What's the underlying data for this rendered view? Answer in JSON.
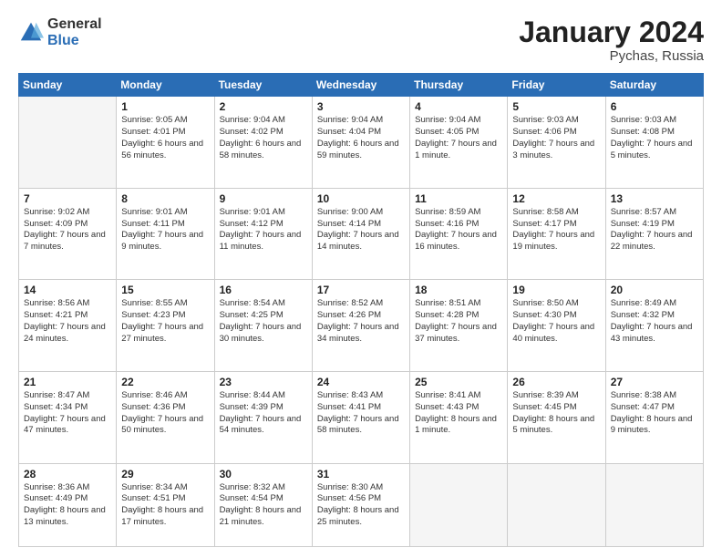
{
  "logo": {
    "general": "General",
    "blue": "Blue"
  },
  "title": {
    "month": "January 2024",
    "location": "Pychas, Russia"
  },
  "days_of_week": [
    "Sunday",
    "Monday",
    "Tuesday",
    "Wednesday",
    "Thursday",
    "Friday",
    "Saturday"
  ],
  "weeks": [
    [
      {
        "day": "",
        "info": ""
      },
      {
        "day": "1",
        "info": "Sunrise: 9:05 AM\nSunset: 4:01 PM\nDaylight: 6 hours\nand 56 minutes."
      },
      {
        "day": "2",
        "info": "Sunrise: 9:04 AM\nSunset: 4:02 PM\nDaylight: 6 hours\nand 58 minutes."
      },
      {
        "day": "3",
        "info": "Sunrise: 9:04 AM\nSunset: 4:04 PM\nDaylight: 6 hours\nand 59 minutes."
      },
      {
        "day": "4",
        "info": "Sunrise: 9:04 AM\nSunset: 4:05 PM\nDaylight: 7 hours\nand 1 minute."
      },
      {
        "day": "5",
        "info": "Sunrise: 9:03 AM\nSunset: 4:06 PM\nDaylight: 7 hours\nand 3 minutes."
      },
      {
        "day": "6",
        "info": "Sunrise: 9:03 AM\nSunset: 4:08 PM\nDaylight: 7 hours\nand 5 minutes."
      }
    ],
    [
      {
        "day": "7",
        "info": "Sunrise: 9:02 AM\nSunset: 4:09 PM\nDaylight: 7 hours\nand 7 minutes."
      },
      {
        "day": "8",
        "info": "Sunrise: 9:01 AM\nSunset: 4:11 PM\nDaylight: 7 hours\nand 9 minutes."
      },
      {
        "day": "9",
        "info": "Sunrise: 9:01 AM\nSunset: 4:12 PM\nDaylight: 7 hours\nand 11 minutes."
      },
      {
        "day": "10",
        "info": "Sunrise: 9:00 AM\nSunset: 4:14 PM\nDaylight: 7 hours\nand 14 minutes."
      },
      {
        "day": "11",
        "info": "Sunrise: 8:59 AM\nSunset: 4:16 PM\nDaylight: 7 hours\nand 16 minutes."
      },
      {
        "day": "12",
        "info": "Sunrise: 8:58 AM\nSunset: 4:17 PM\nDaylight: 7 hours\nand 19 minutes."
      },
      {
        "day": "13",
        "info": "Sunrise: 8:57 AM\nSunset: 4:19 PM\nDaylight: 7 hours\nand 22 minutes."
      }
    ],
    [
      {
        "day": "14",
        "info": "Sunrise: 8:56 AM\nSunset: 4:21 PM\nDaylight: 7 hours\nand 24 minutes."
      },
      {
        "day": "15",
        "info": "Sunrise: 8:55 AM\nSunset: 4:23 PM\nDaylight: 7 hours\nand 27 minutes."
      },
      {
        "day": "16",
        "info": "Sunrise: 8:54 AM\nSunset: 4:25 PM\nDaylight: 7 hours\nand 30 minutes."
      },
      {
        "day": "17",
        "info": "Sunrise: 8:52 AM\nSunset: 4:26 PM\nDaylight: 7 hours\nand 34 minutes."
      },
      {
        "day": "18",
        "info": "Sunrise: 8:51 AM\nSunset: 4:28 PM\nDaylight: 7 hours\nand 37 minutes."
      },
      {
        "day": "19",
        "info": "Sunrise: 8:50 AM\nSunset: 4:30 PM\nDaylight: 7 hours\nand 40 minutes."
      },
      {
        "day": "20",
        "info": "Sunrise: 8:49 AM\nSunset: 4:32 PM\nDaylight: 7 hours\nand 43 minutes."
      }
    ],
    [
      {
        "day": "21",
        "info": "Sunrise: 8:47 AM\nSunset: 4:34 PM\nDaylight: 7 hours\nand 47 minutes."
      },
      {
        "day": "22",
        "info": "Sunrise: 8:46 AM\nSunset: 4:36 PM\nDaylight: 7 hours\nand 50 minutes."
      },
      {
        "day": "23",
        "info": "Sunrise: 8:44 AM\nSunset: 4:39 PM\nDaylight: 7 hours\nand 54 minutes."
      },
      {
        "day": "24",
        "info": "Sunrise: 8:43 AM\nSunset: 4:41 PM\nDaylight: 7 hours\nand 58 minutes."
      },
      {
        "day": "25",
        "info": "Sunrise: 8:41 AM\nSunset: 4:43 PM\nDaylight: 8 hours\nand 1 minute."
      },
      {
        "day": "26",
        "info": "Sunrise: 8:39 AM\nSunset: 4:45 PM\nDaylight: 8 hours\nand 5 minutes."
      },
      {
        "day": "27",
        "info": "Sunrise: 8:38 AM\nSunset: 4:47 PM\nDaylight: 8 hours\nand 9 minutes."
      }
    ],
    [
      {
        "day": "28",
        "info": "Sunrise: 8:36 AM\nSunset: 4:49 PM\nDaylight: 8 hours\nand 13 minutes."
      },
      {
        "day": "29",
        "info": "Sunrise: 8:34 AM\nSunset: 4:51 PM\nDaylight: 8 hours\nand 17 minutes."
      },
      {
        "day": "30",
        "info": "Sunrise: 8:32 AM\nSunset: 4:54 PM\nDaylight: 8 hours\nand 21 minutes."
      },
      {
        "day": "31",
        "info": "Sunrise: 8:30 AM\nSunset: 4:56 PM\nDaylight: 8 hours\nand 25 minutes."
      },
      {
        "day": "",
        "info": ""
      },
      {
        "day": "",
        "info": ""
      },
      {
        "day": "",
        "info": ""
      }
    ]
  ]
}
